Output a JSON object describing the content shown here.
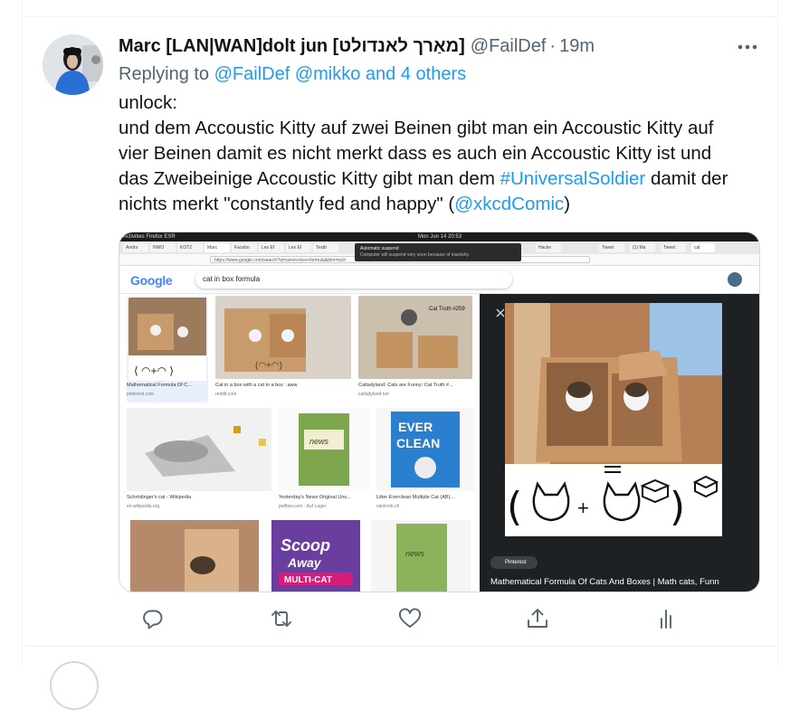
{
  "tweet": {
    "author_name": "Marc [LAN|WAN]dolt jun [מאַרך לאנדולט]",
    "author_handle": "@FailDef",
    "separator": "·",
    "time": "19m",
    "replying_prefix": "Replying to",
    "replying_to": "@FailDef @mikko and 4 others",
    "text_line1": "unlock:",
    "text_line2": "und dem Accoustic Kitty auf zwei Beinen gibt man ein Accoustic Kitty auf",
    "text_line3": "vier Beinen damit es nicht merkt dass es auch ein Accoustic Kitty ist und",
    "text_line4_a": "das Zweibeinige Accoustic Kitty gibt man dem ",
    "hashtag": "#UniversalSoldier",
    "text_line4_b": " damit der",
    "text_line5_a": "nichts merkt \"constantly fed and happy\" (",
    "mention": "@xkcdComic",
    "text_line5_b": ")"
  },
  "media": {
    "os_bar_left": "Activities   Firefox ESR",
    "os_bar_center": "Mon Jun 14  20:53",
    "tabs": [
      "Andro",
      "NWO",
      "KOTZ",
      "Marc",
      "Facebo",
      "Les Ef",
      "Les Ef",
      "Testb",
      "Hacke",
      "Tweet",
      "(1) Ma",
      "Tweet",
      "cat"
    ],
    "url": "https://www.google.com/search?q=cat+in+box+formula&tbm=isch",
    "notification_title": "Automatic suspend",
    "notification_body": "Computer will suspend very soon because of inactivity.",
    "google_logo": "Google",
    "search_query": "cat in box formula",
    "results": [
      {
        "caption": "Mathematical Formula Of C...",
        "source": "pinterest.com"
      },
      {
        "caption": "Cat in a box with a cat in a box : aww",
        "source": "reddit.com"
      },
      {
        "caption": "Catladyland: Cats are Funny: Cat Truth #...",
        "source": "catladyland.net"
      },
      {
        "caption": "Schrödinger's cat - Wikipedia",
        "source": "en.wikipedia.org"
      },
      {
        "caption": "Yesterday's News Original Uns...",
        "source": "petflow.com · Auf Lager"
      },
      {
        "caption": "Litter Everclean Multiple Cat (AB)...",
        "source": "canicrok.ch"
      }
    ],
    "viewer_source": "Pinterest",
    "viewer_caption": "Mathematical Formula Of Cats And Boxes | Math cats, Funn"
  },
  "colors": {
    "link": "#1d9bf0",
    "secondary_text": "#536471",
    "primary_text": "#0f1419",
    "border": "#eff3f4"
  },
  "icons": [
    "more-icon",
    "reply-icon",
    "retweet-icon",
    "like-icon",
    "share-icon",
    "analytics-icon"
  ]
}
